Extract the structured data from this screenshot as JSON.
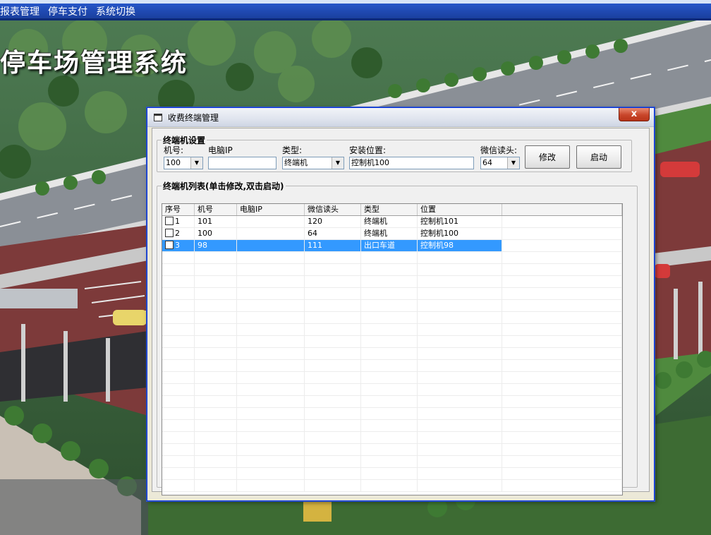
{
  "menu": {
    "items": [
      "报表管理",
      "停车支付",
      "系统切换"
    ]
  },
  "app": {
    "title": "停车场管理系统"
  },
  "dialog": {
    "title": "收费终端管理",
    "close_label": "x",
    "settings": {
      "legend": "终端机设置",
      "machine_no_label": "机号:",
      "machine_no_value": "100",
      "pc_ip_label": "电脑IP",
      "pc_ip_value": "",
      "type_label": "类型:",
      "type_value": "终端机",
      "location_label": "安装位置:",
      "location_value": "控制机100",
      "wechat_label": "微信读头:",
      "wechat_value": "64",
      "modify_button": "修改",
      "start_button": "启动"
    },
    "list": {
      "legend": "终端机列表(单击修改,双击启动)",
      "columns": [
        "序号",
        "机号",
        "电脑IP",
        "微信读头",
        "类型",
        "位置"
      ],
      "rows": [
        {
          "seq": "1",
          "machine_no": "101",
          "pc_ip": "",
          "wechat": "120",
          "type": "终端机",
          "location": "控制机101",
          "checked": false,
          "selected": false
        },
        {
          "seq": "2",
          "machine_no": "100",
          "pc_ip": "",
          "wechat": "64",
          "type": "终端机",
          "location": "控制机100",
          "checked": false,
          "selected": false
        },
        {
          "seq": "3",
          "machine_no": "98",
          "pc_ip": "",
          "wechat": "111",
          "type": "出口车道",
          "location": "控制机98",
          "checked": false,
          "selected": true
        }
      ]
    }
  },
  "colors": {
    "menubar": "#1a3f9e",
    "selection": "#3399ff",
    "close_button": "#c8452a"
  }
}
